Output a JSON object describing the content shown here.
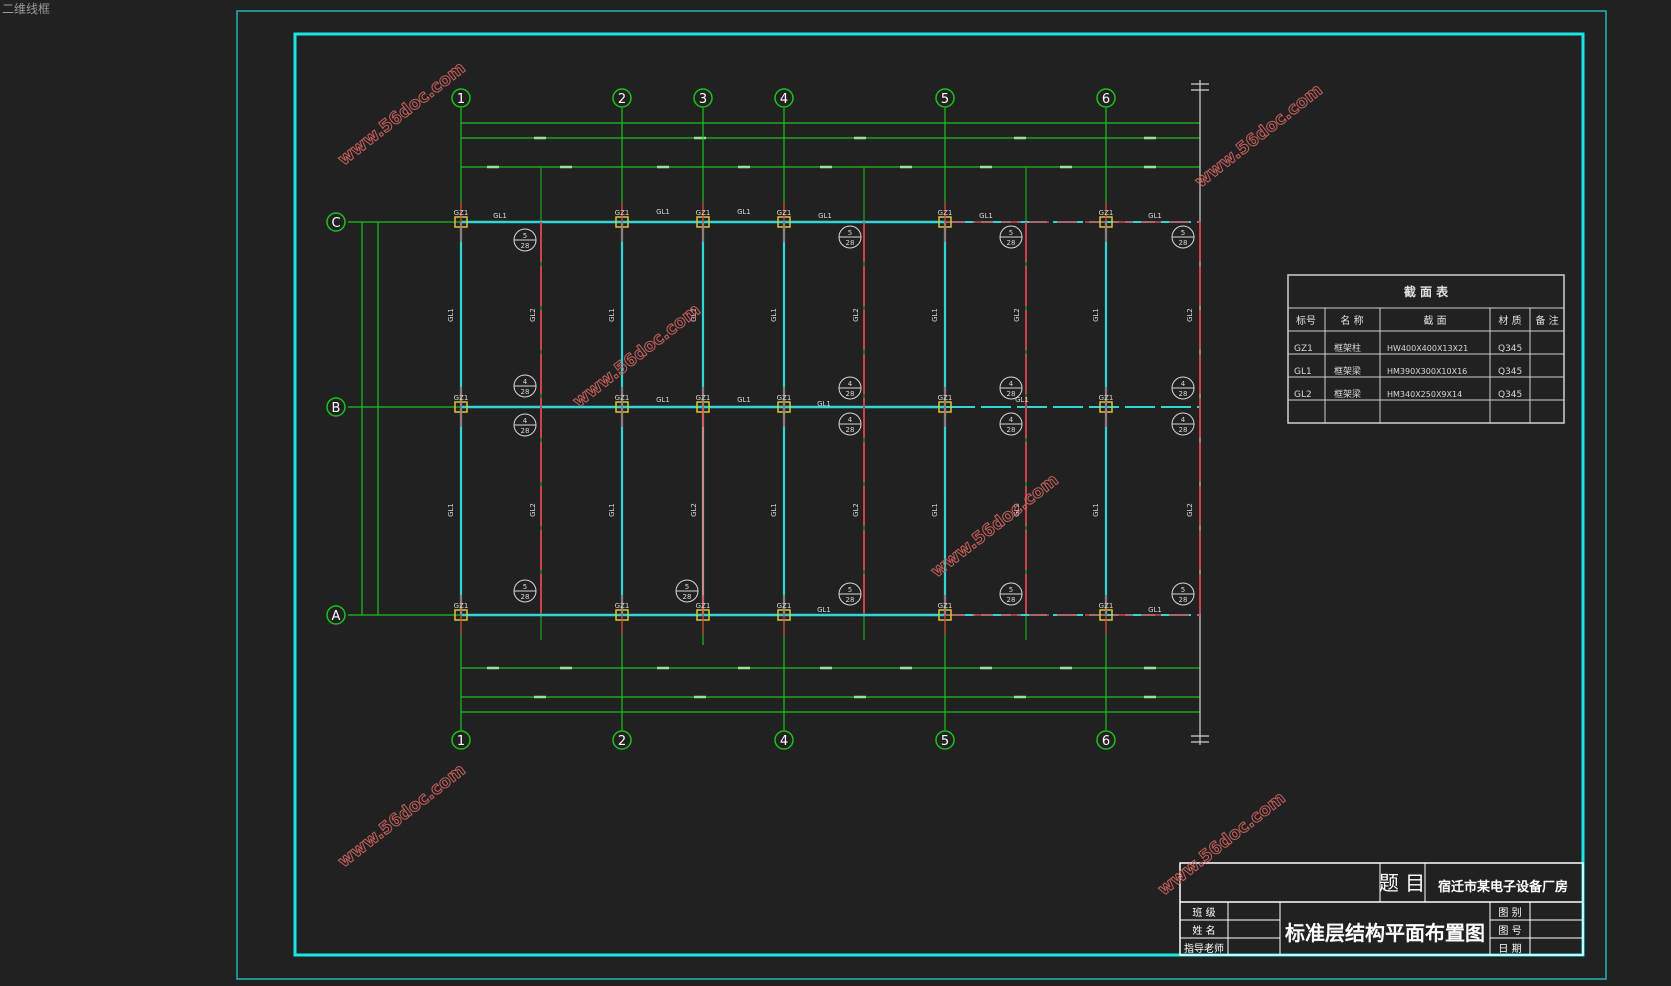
{
  "viewport_label": "二维线框",
  "colors": {
    "background": "#212121",
    "outer_frame": "#1fb4b4",
    "inner_frame": "#19e6e6",
    "axis_line": "#19c319",
    "beam_gl1": "#2fd6d6",
    "beam_gl2": "#c8464b",
    "column": "#e0c23a",
    "watermark": "#c8605c",
    "text": "#d8d8d8"
  },
  "watermark_text": "www.56doc.com",
  "grid_axes": {
    "top": [
      "1",
      "2",
      "3",
      "4",
      "5",
      "6"
    ],
    "bottom": [
      "1",
      "2",
      "4",
      "5",
      "6"
    ],
    "side": [
      "C",
      "B",
      "A"
    ]
  },
  "member_labels": {
    "column": "GZ1",
    "main_beam": "GL1",
    "secondary_beam": "GL2",
    "detail_top": "5",
    "detail_mid": "4",
    "detail_bottom": "28"
  },
  "section_table": {
    "title": "截 面 表",
    "headers": [
      "标号",
      "名 称",
      "截 面",
      "材 质",
      "备 注"
    ],
    "rows": [
      [
        "GZ1",
        "框架柱",
        "HW400X400X13X21",
        "Q345",
        ""
      ],
      [
        "GL1",
        "框架梁",
        "HM390X300X10X16",
        "Q345",
        ""
      ],
      [
        "GL2",
        "框架梁",
        "HM340X250X9X14",
        "Q345",
        ""
      ],
      [
        "",
        "",
        "",
        "",
        ""
      ]
    ]
  },
  "title_block": {
    "topic_label": "题 目",
    "topic_value": "宿迁市某电子设备厂房",
    "drawing_name": "标准层结构平面布置图",
    "left_labels": [
      "班 级",
      "姓 名",
      "指导老师"
    ],
    "right_labels": [
      "图 别",
      "图 号",
      "日 期"
    ]
  }
}
